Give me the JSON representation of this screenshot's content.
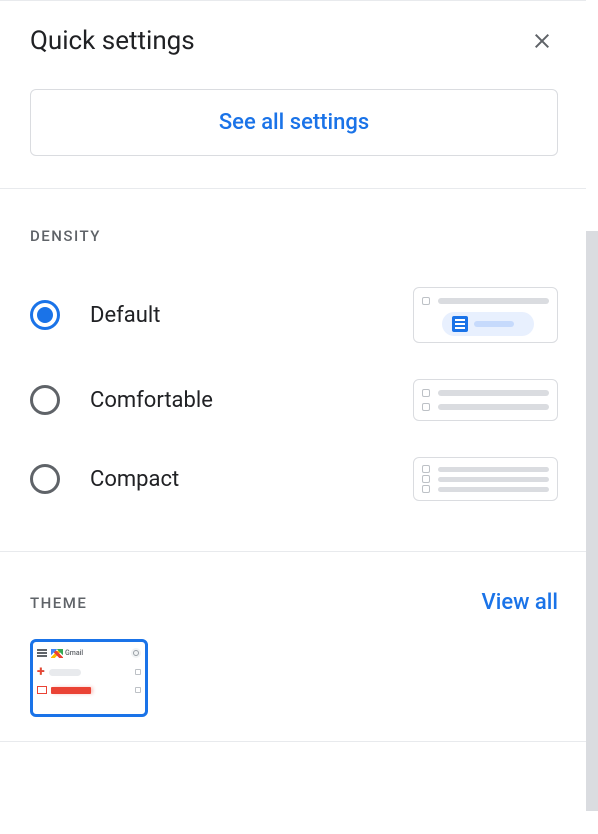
{
  "header": {
    "title": "Quick settings"
  },
  "buttons": {
    "see_all": "See all settings",
    "view_all": "View all"
  },
  "sections": {
    "density": "DENSITY",
    "theme": "THEME"
  },
  "density": {
    "options": [
      {
        "label": "Default",
        "selected": true
      },
      {
        "label": "Comfortable",
        "selected": false
      },
      {
        "label": "Compact",
        "selected": false
      }
    ]
  },
  "theme": {
    "gmail_label": "Gmail"
  }
}
